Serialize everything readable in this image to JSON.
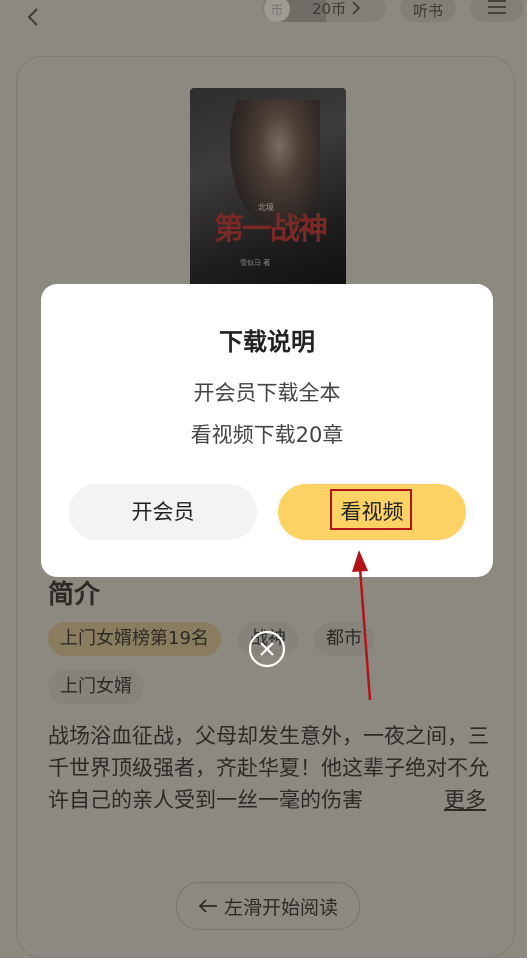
{
  "header": {
    "coin_badge": "币",
    "coin_label": "20币",
    "listen_label": "听书"
  },
  "book": {
    "cover_title": "第一战神",
    "cover_subtitle": "北境",
    "cover_author": "雪似马 著"
  },
  "intro": {
    "title": "简介",
    "tags": [
      "上门女婿榜第19名",
      "战神",
      "都市",
      "上门女婿"
    ],
    "synopsis": "战场浴血征战，父母却发生意外，一夜之间，三千世界顶级强者，齐赴华夏！他这辈子绝对不允许自己的亲人受到一丝一毫的伤害",
    "more_label": "更多"
  },
  "read_button": {
    "label": "左滑开始阅读"
  },
  "dialog": {
    "title": "下载说明",
    "line1": "开会员下载全本",
    "line2": "看视频下载20章",
    "member_button": "开会员",
    "video_button": "看视频"
  },
  "colors": {
    "accent": "#fdd265",
    "annotation": "#b3141a"
  },
  "icons": [
    "back-icon",
    "chevron-right-icon",
    "menu-icon",
    "arrow-left-icon",
    "close-icon"
  ]
}
